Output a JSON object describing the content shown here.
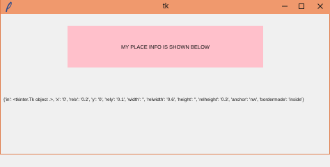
{
  "window": {
    "title": "tk",
    "controls": {
      "minimize_glyph": "–",
      "maximize_glyph": "☐",
      "close_glyph": "✕"
    },
    "titlebar_color": "#f0996d",
    "icon": "feather-icon"
  },
  "content": {
    "label_text": "MY PLACE INFO IS SHOWN BELOW",
    "label_bg": "#ffc0cb",
    "place_info": "{'in': <tkinter.Tk object .>, 'x': '0', 'relx': '0.2', 'y': '0', 'rely': '0.1', 'width': '', 'relwidth': '0.6', 'height': '', 'relheight': '0.3', 'anchor': 'nw', 'bordermode': 'inside'}"
  }
}
